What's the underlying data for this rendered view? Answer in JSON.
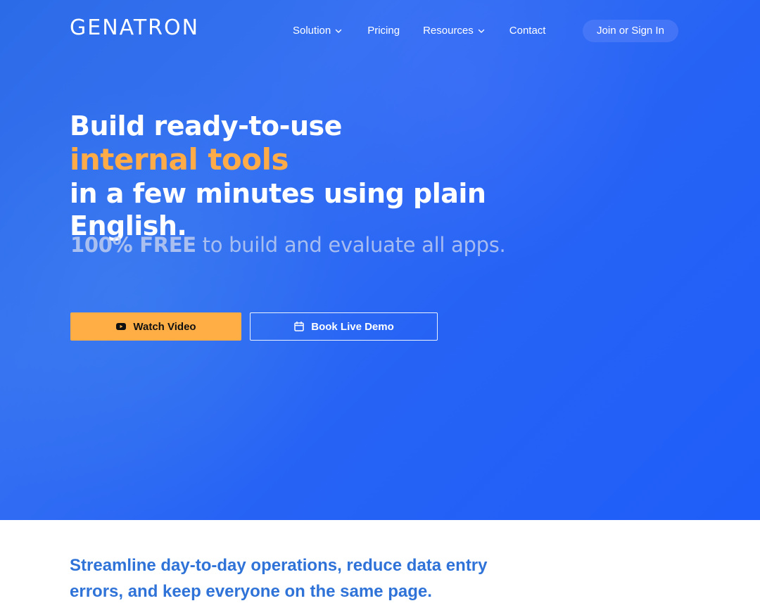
{
  "brand": {
    "logo_text": "GENATRON"
  },
  "nav": {
    "solution_label": "Solution",
    "pricing_label": "Pricing",
    "resources_label": "Resources",
    "contact_label": "Contact",
    "signin_label": "Join or Sign In"
  },
  "hero": {
    "headline_line1": "Build ready-to-use",
    "headline_line2": "internal tools",
    "headline_line3": "in a few minutes using plain English.",
    "sub_strong": "100% FREE",
    "sub_rest": " to build and evaluate all apps.",
    "watch_video_label": "Watch Video",
    "book_demo_label": "Book Live Demo"
  },
  "lower": {
    "tagline": "Streamline day-to-day operations, reduce data entry errors, and keep everyone on the same page."
  },
  "colors": {
    "hero_blue": "#2663f5",
    "accent_orange": "#ffae45",
    "tagline_blue": "#2f73d8"
  },
  "icons": {
    "video": "youtube-icon",
    "calendar": "calendar-icon",
    "dropdown": "chevron-down-icon"
  }
}
